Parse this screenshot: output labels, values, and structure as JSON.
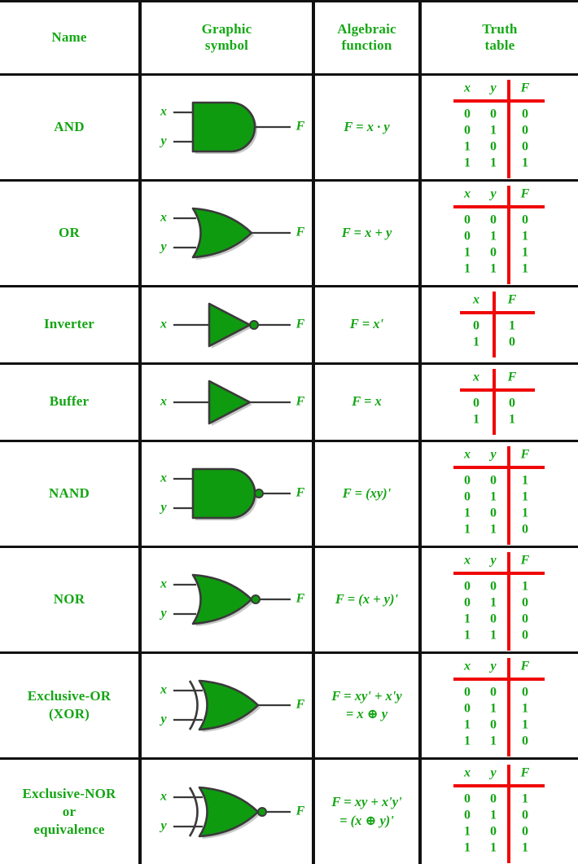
{
  "table": {
    "headers": [
      {
        "key": "name",
        "line1": "Name",
        "line2": ""
      },
      {
        "key": "symbol",
        "line1": "Graphic",
        "line2": "symbol"
      },
      {
        "key": "alg",
        "line1": "Algebraic",
        "line2": "function"
      },
      {
        "key": "tt",
        "line1": "Truth",
        "line2": "table"
      }
    ],
    "rows": [
      {
        "id": "and",
        "name_lines": [
          "AND"
        ],
        "symbol": "and-gate-symbol",
        "inputs": [
          "x",
          "y"
        ],
        "output": "F",
        "algebraic_lines": [
          "F = x · y"
        ],
        "truth_table": {
          "columns": [
            "x",
            "y",
            "F"
          ],
          "rows": [
            [
              "0",
              "0",
              "0"
            ],
            [
              "0",
              "1",
              "0"
            ],
            [
              "1",
              "0",
              "0"
            ],
            [
              "1",
              "1",
              "1"
            ]
          ]
        }
      },
      {
        "id": "or",
        "name_lines": [
          "OR"
        ],
        "symbol": "or-gate-symbol",
        "inputs": [
          "x",
          "y"
        ],
        "output": "F",
        "algebraic_lines": [
          "F = x + y"
        ],
        "truth_table": {
          "columns": [
            "x",
            "y",
            "F"
          ],
          "rows": [
            [
              "0",
              "0",
              "0"
            ],
            [
              "0",
              "1",
              "1"
            ],
            [
              "1",
              "0",
              "1"
            ],
            [
              "1",
              "1",
              "1"
            ]
          ]
        }
      },
      {
        "id": "inverter",
        "name_lines": [
          "Inverter"
        ],
        "symbol": "inverter-gate-symbol",
        "inputs": [
          "x"
        ],
        "output": "F",
        "algebraic_lines": [
          "F = x'"
        ],
        "truth_table": {
          "columns": [
            "x",
            "F"
          ],
          "rows": [
            [
              "0",
              "1"
            ],
            [
              "1",
              "0"
            ]
          ]
        }
      },
      {
        "id": "buffer",
        "name_lines": [
          "Buffer"
        ],
        "symbol": "buffer-gate-symbol",
        "inputs": [
          "x"
        ],
        "output": "F",
        "algebraic_lines": [
          "F = x"
        ],
        "truth_table": {
          "columns": [
            "x",
            "F"
          ],
          "rows": [
            [
              "0",
              "0"
            ],
            [
              "1",
              "1"
            ]
          ]
        }
      },
      {
        "id": "nand",
        "name_lines": [
          "NAND"
        ],
        "symbol": "nand-gate-symbol",
        "inputs": [
          "x",
          "y"
        ],
        "output": "F",
        "algebraic_lines": [
          "F = (xy)'"
        ],
        "truth_table": {
          "columns": [
            "x",
            "y",
            "F"
          ],
          "rows": [
            [
              "0",
              "0",
              "1"
            ],
            [
              "0",
              "1",
              "1"
            ],
            [
              "1",
              "0",
              "1"
            ],
            [
              "1",
              "1",
              "0"
            ]
          ]
        }
      },
      {
        "id": "nor",
        "name_lines": [
          "NOR"
        ],
        "symbol": "nor-gate-symbol",
        "inputs": [
          "x",
          "y"
        ],
        "output": "F",
        "algebraic_lines": [
          "F = (x + y)'"
        ],
        "truth_table": {
          "columns": [
            "x",
            "y",
            "F"
          ],
          "rows": [
            [
              "0",
              "0",
              "1"
            ],
            [
              "0",
              "1",
              "0"
            ],
            [
              "1",
              "0",
              "0"
            ],
            [
              "1",
              "1",
              "0"
            ]
          ]
        }
      },
      {
        "id": "xor",
        "name_lines": [
          "Exclusive-OR",
          "(XOR)"
        ],
        "symbol": "xor-gate-symbol",
        "inputs": [
          "x",
          "y"
        ],
        "output": "F",
        "algebraic_lines": [
          "F = xy' + x'y",
          "= x ⊕ y"
        ],
        "truth_table": {
          "columns": [
            "x",
            "y",
            "F"
          ],
          "rows": [
            [
              "0",
              "0",
              "0"
            ],
            [
              "0",
              "1",
              "1"
            ],
            [
              "1",
              "0",
              "1"
            ],
            [
              "1",
              "1",
              "0"
            ]
          ]
        }
      },
      {
        "id": "xnor",
        "name_lines": [
          "Exclusive-NOR",
          "or",
          "equivalence"
        ],
        "symbol": "xnor-gate-symbol",
        "inputs": [
          "x",
          "y"
        ],
        "output": "F",
        "algebraic_lines": [
          "F = xy + x'y'",
          "= (x ⊕ y)'"
        ],
        "truth_table": {
          "columns": [
            "x",
            "y",
            "F"
          ],
          "rows": [
            [
              "0",
              "0",
              "1"
            ],
            [
              "0",
              "1",
              "0"
            ],
            [
              "1",
              "0",
              "0"
            ],
            [
              "1",
              "1",
              "1"
            ]
          ]
        }
      }
    ]
  },
  "colors": {
    "text_green": "#14a514",
    "gate_fill": "#0f9b0f",
    "gate_outline": "#3a3a3a",
    "rule_red": "#f00808",
    "border_black": "#111111",
    "background": "#ffffff"
  }
}
